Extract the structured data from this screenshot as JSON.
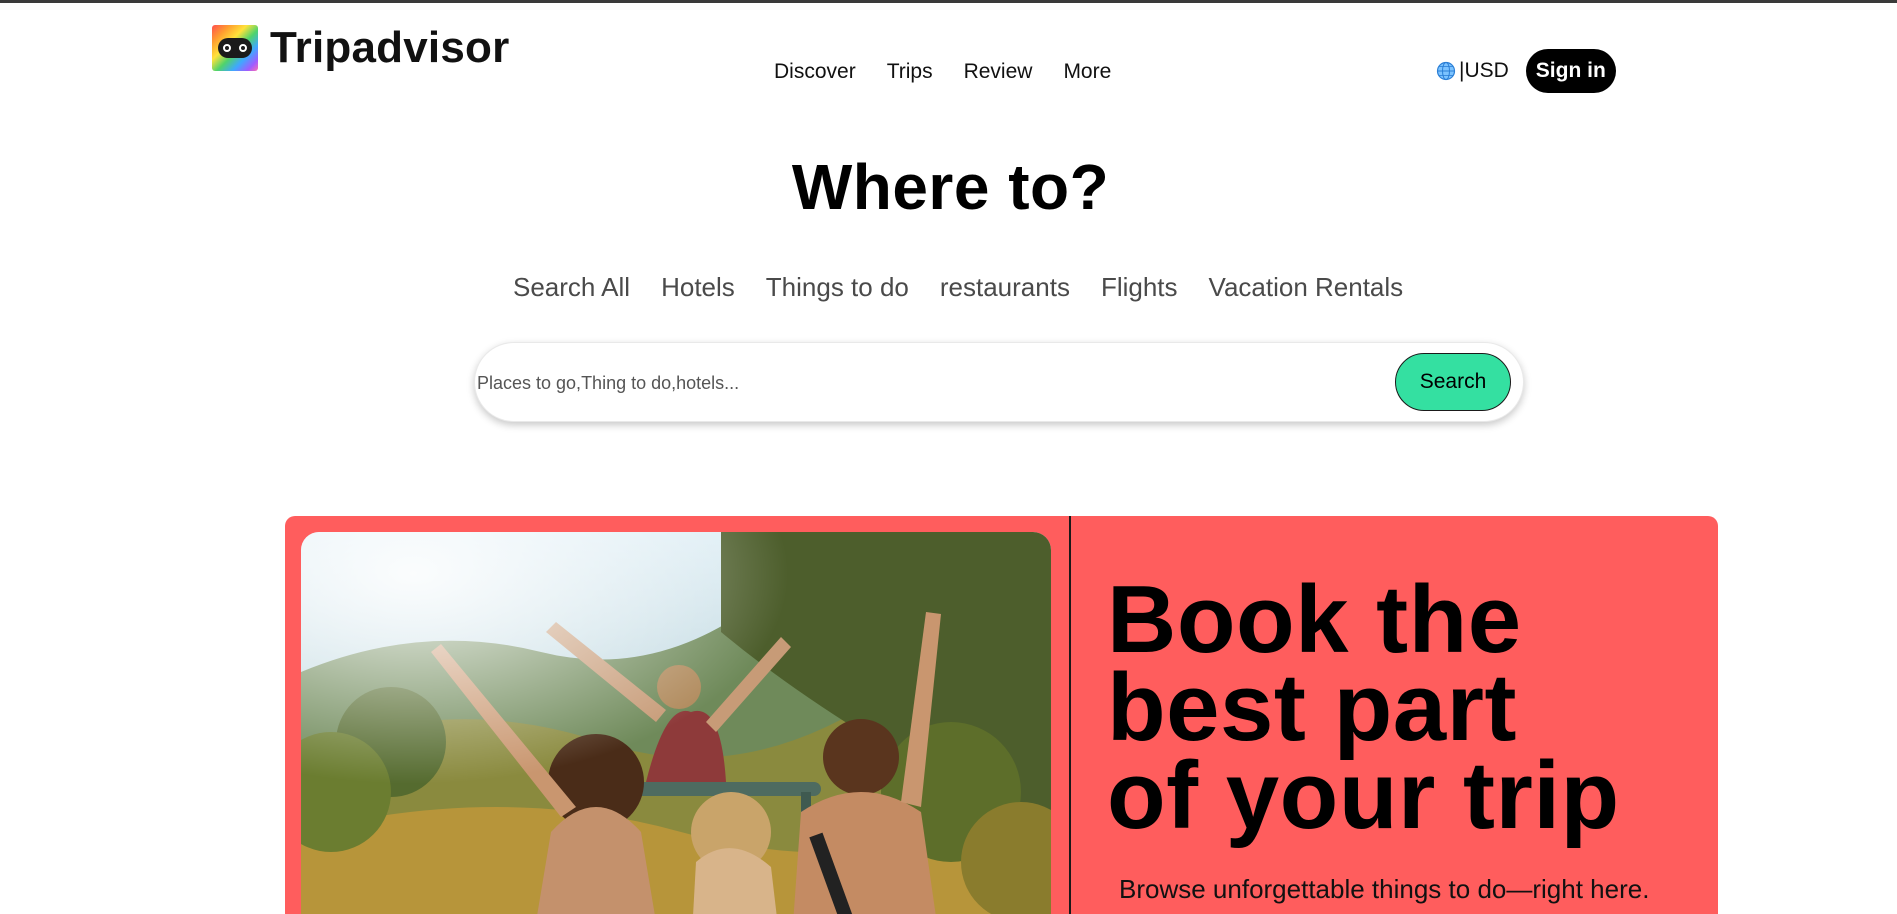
{
  "brand": {
    "name": "Tripadvisor",
    "logo_icon": "owl-logo-icon"
  },
  "nav": {
    "items": [
      {
        "label": "Discover"
      },
      {
        "label": "Trips"
      },
      {
        "label": "Review"
      },
      {
        "label": "More"
      }
    ]
  },
  "toolbar": {
    "globe_icon": "globe-icon",
    "currency_label": "|USD",
    "sign_in_label": "Sign in"
  },
  "hero": {
    "title": "Where to?",
    "categories": [
      {
        "label": "Search All"
      },
      {
        "label": "Hotels"
      },
      {
        "label": "Things to do"
      },
      {
        "label": "restaurants"
      },
      {
        "label": "Flights"
      },
      {
        "label": "Vacation Rentals"
      }
    ],
    "search": {
      "placeholder": "Places to go,Thing to do,hotels...",
      "value": "",
      "button_label": "Search"
    }
  },
  "promo": {
    "headline_lines": [
      "Book the",
      "best part",
      "of your trip"
    ],
    "subtitle": "Browse unforgettable things to do—right here.",
    "colors": {
      "background": "#ff5d5d"
    }
  },
  "colors": {
    "accent": "#34e0a1",
    "text": "#000000",
    "category_text": "#4a4a4a"
  }
}
